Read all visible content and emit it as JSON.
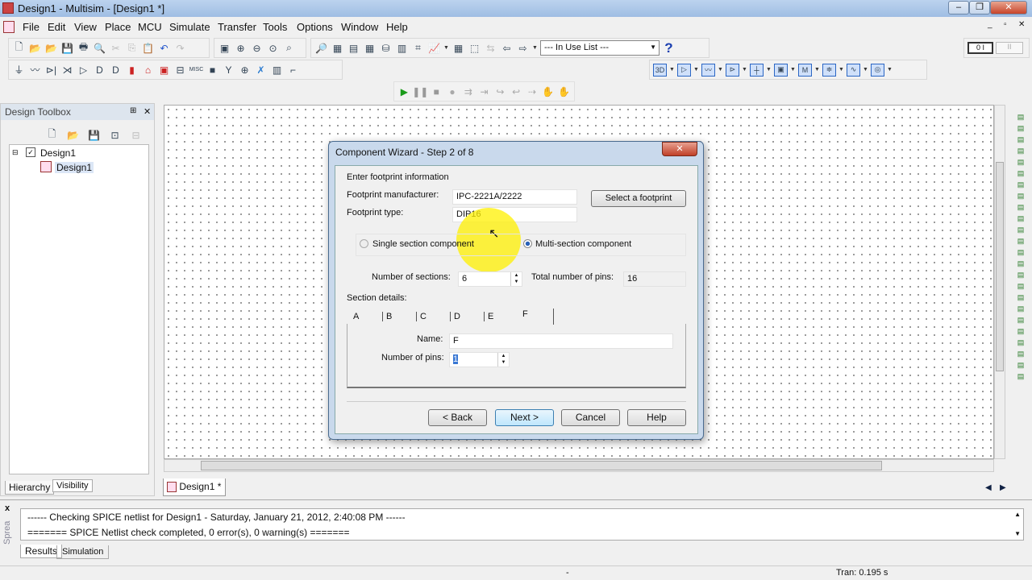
{
  "window": {
    "title": "Design1 - Multisim - [Design1 *]",
    "min": "‒",
    "restore": "❐",
    "close": "✕"
  },
  "menu": [
    "File",
    "Edit",
    "View",
    "Place",
    "MCU",
    "Simulate",
    "Transfer",
    "Tools",
    "Options",
    "Window",
    "Help"
  ],
  "mdi_controls": {
    "min": "_",
    "restore": "▫",
    "close": "✕"
  },
  "toolbar": {
    "in_use_list": "--- In Use List ---",
    "help": "?"
  },
  "toolbox": {
    "title": "Design Toolbox",
    "pin": "⊞",
    "close": "✕",
    "tree": [
      {
        "label": "Design1"
      },
      {
        "label": "Design1"
      }
    ],
    "tabs": [
      "Hierarchy",
      "Visibility"
    ]
  },
  "document_tab": "Design1 *",
  "output": {
    "lines": [
      "------ Checking SPICE netlist for Design1 - Saturday, January 21, 2012, 2:40:08 PM ------",
      "======= SPICE Netlist check completed, 0 error(s), 0 warning(s) ======="
    ],
    "tabs": [
      "Results",
      "Simulation"
    ],
    "side_label": "Sprea",
    "close": "x"
  },
  "status": {
    "middle": "-",
    "sim": "Tran: 0.195 s"
  },
  "dialog": {
    "title": "Component Wizard - Step 2 of 8",
    "close": "✕",
    "heading": "Enter footprint information",
    "manufacturer_label": "Footprint manufacturer:",
    "manufacturer_value": "IPC-2221A/2222",
    "type_label": "Footprint type:",
    "type_value": "DIP16",
    "select_footprint": "Select a footprint",
    "single_section": "Single section component",
    "multi_section": "Multi-section component",
    "selected_mode": "multi",
    "sections_label": "Number of sections:",
    "sections_value": "6",
    "total_pins_label": "Total number of pins:",
    "total_pins_value": "16",
    "section_details": "Section details:",
    "section_tabs": [
      "A",
      "B",
      "C",
      "D",
      "E",
      "F"
    ],
    "active_tab": "F",
    "name_label": "Name:",
    "name_value": "F",
    "pins_label": "Number of pins:",
    "pins_value": "1",
    "buttons": {
      "back": "< Back",
      "next": "Next >",
      "cancel": "Cancel",
      "help": "Help"
    }
  }
}
